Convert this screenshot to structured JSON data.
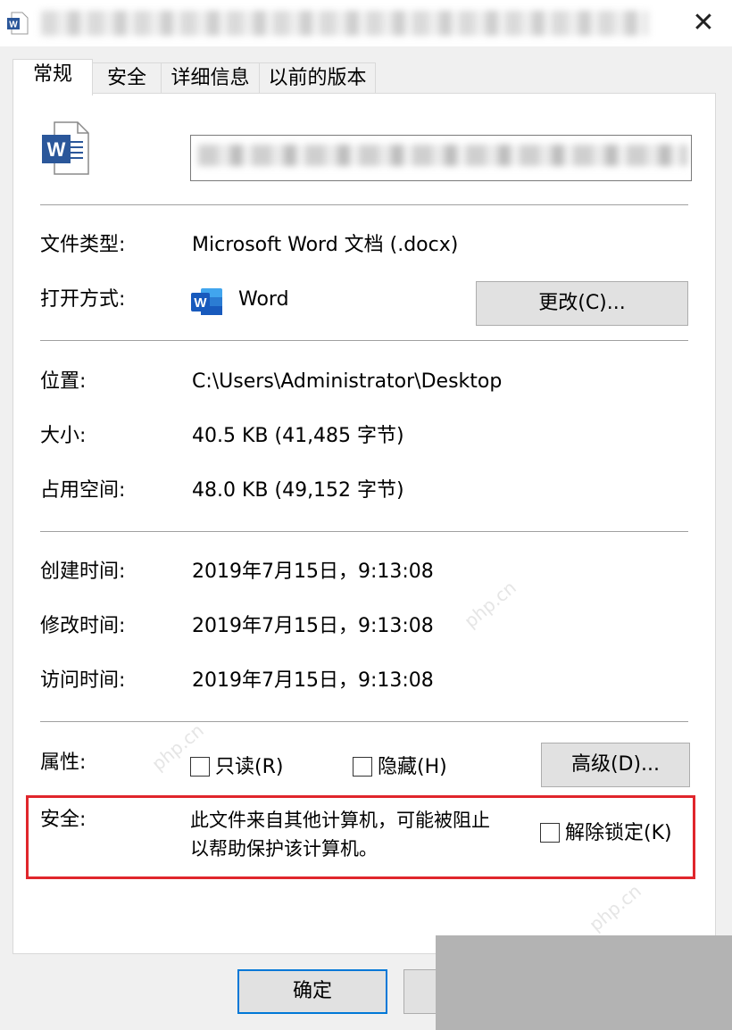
{
  "window": {
    "close_symbol": "✕"
  },
  "tabs": [
    {
      "label": "常规",
      "active": true
    },
    {
      "label": "安全"
    },
    {
      "label": "详细信息"
    },
    {
      "label": "以前的版本"
    }
  ],
  "file_info": {
    "type_label": "文件类型:",
    "type_value": "Microsoft Word 文档 (.docx)",
    "open_with_label": "打开方式:",
    "open_with_value": "Word",
    "change_button": "更改(C)...",
    "location_label": "位置:",
    "location_value": "C:\\Users\\Administrator\\Desktop",
    "size_label": "大小:",
    "size_value": "40.5 KB (41,485 字节)",
    "disk_size_label": "占用空间:",
    "disk_size_value": "48.0 KB (49,152 字节)"
  },
  "times": {
    "created_label": "创建时间:",
    "created_value": "2019年7月15日，9:13:08",
    "modified_label": "修改时间:",
    "modified_value": "2019年7月15日，9:13:08",
    "accessed_label": "访问时间:",
    "accessed_value": "2019年7月15日，9:13:08"
  },
  "attributes": {
    "label": "属性:",
    "readonly": "只读(R)",
    "hidden": "隐藏(H)",
    "advanced_button": "高级(D)..."
  },
  "security": {
    "label": "安全:",
    "message_line1": "此文件来自其他计算机，可能被阻止",
    "message_line2": "以帮助保护该计算机。",
    "unblock": "解除锁定(K)"
  },
  "footer": {
    "ok_button": "确定"
  },
  "icons": {
    "app": "word-doc-icon",
    "file": "word-doc-icon",
    "open_with": "word-app-icon"
  },
  "colors": {
    "word_blue": "#2b579a",
    "highlight_red": "#e0262c",
    "focus_blue": "#0078d7"
  }
}
